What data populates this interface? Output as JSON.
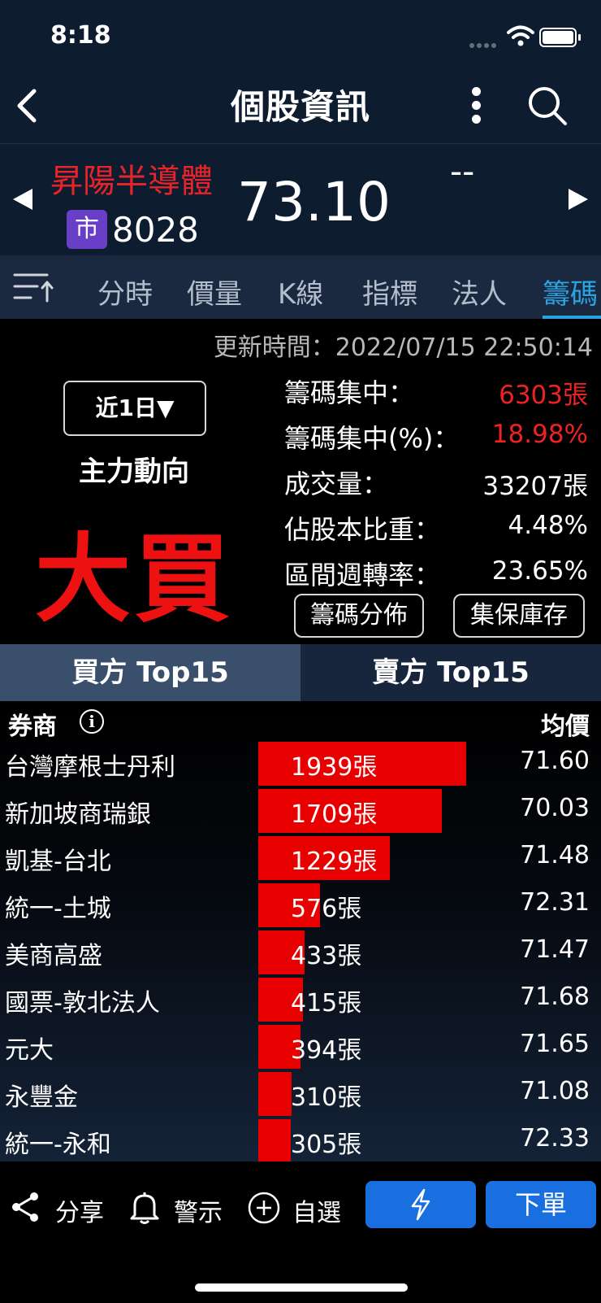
{
  "status": {
    "time": "8:18"
  },
  "nav": {
    "title": "個股資訊"
  },
  "stock": {
    "name": "昇陽半導體",
    "market_badge": "市",
    "code": "8028",
    "price": "73.10",
    "change": "--"
  },
  "tabs": [
    {
      "label": "分時"
    },
    {
      "label": "價量"
    },
    {
      "label": "K線"
    },
    {
      "label": "指標"
    },
    {
      "label": "法人"
    },
    {
      "label": "籌碼",
      "active": true
    }
  ],
  "info": {
    "update_time": "更新時間：2022/07/15 22:50:14",
    "period": "近1日▼",
    "main_trend_label": "主力動向",
    "main_trend_value": "大買",
    "stats": [
      {
        "label": "籌碼集中：",
        "value": "6303張"
      },
      {
        "label": "籌碼集中(%)：",
        "value": "18.98%"
      },
      {
        "label": "成交量：",
        "value": "33207張"
      },
      {
        "label": "佔股本比重：",
        "value": "4.48%"
      },
      {
        "label": "區間週轉率：",
        "value": "23.65%"
      }
    ],
    "dist_button": "籌碼分佈",
    "custody_button": "集保庫存",
    "accent_red": "#ee2222"
  },
  "top15": {
    "buy_tab": "買方 Top15",
    "sell_tab": "賣方 Top15"
  },
  "list": {
    "col_broker": "券商",
    "col_avg": "均價",
    "rows": [
      {
        "broker": "台灣摩根士丹利",
        "qty": "1939張",
        "qty_num": 1939,
        "avg": "71.60"
      },
      {
        "broker": "新加坡商瑞銀",
        "qty": "1709張",
        "qty_num": 1709,
        "avg": "70.03"
      },
      {
        "broker": "凱基-台北",
        "qty": "1229張",
        "qty_num": 1229,
        "avg": "71.48"
      },
      {
        "broker": "統一-土城",
        "qty": "576張",
        "qty_num": 576,
        "avg": "72.31"
      },
      {
        "broker": "美商高盛",
        "qty": "433張",
        "qty_num": 433,
        "avg": "71.47"
      },
      {
        "broker": "國票-敦北法人",
        "qty": "415張",
        "qty_num": 415,
        "avg": "71.68"
      },
      {
        "broker": "元大",
        "qty": "394張",
        "qty_num": 394,
        "avg": "71.65"
      },
      {
        "broker": "永豐金",
        "qty": "310張",
        "qty_num": 310,
        "avg": "71.08"
      },
      {
        "broker": "統一-永和",
        "qty": "305張",
        "qty_num": 305,
        "avg": "72.33"
      }
    ]
  },
  "toolbar": {
    "share": "分享",
    "alert": "警示",
    "watchlist": "自選",
    "order": "下單"
  }
}
